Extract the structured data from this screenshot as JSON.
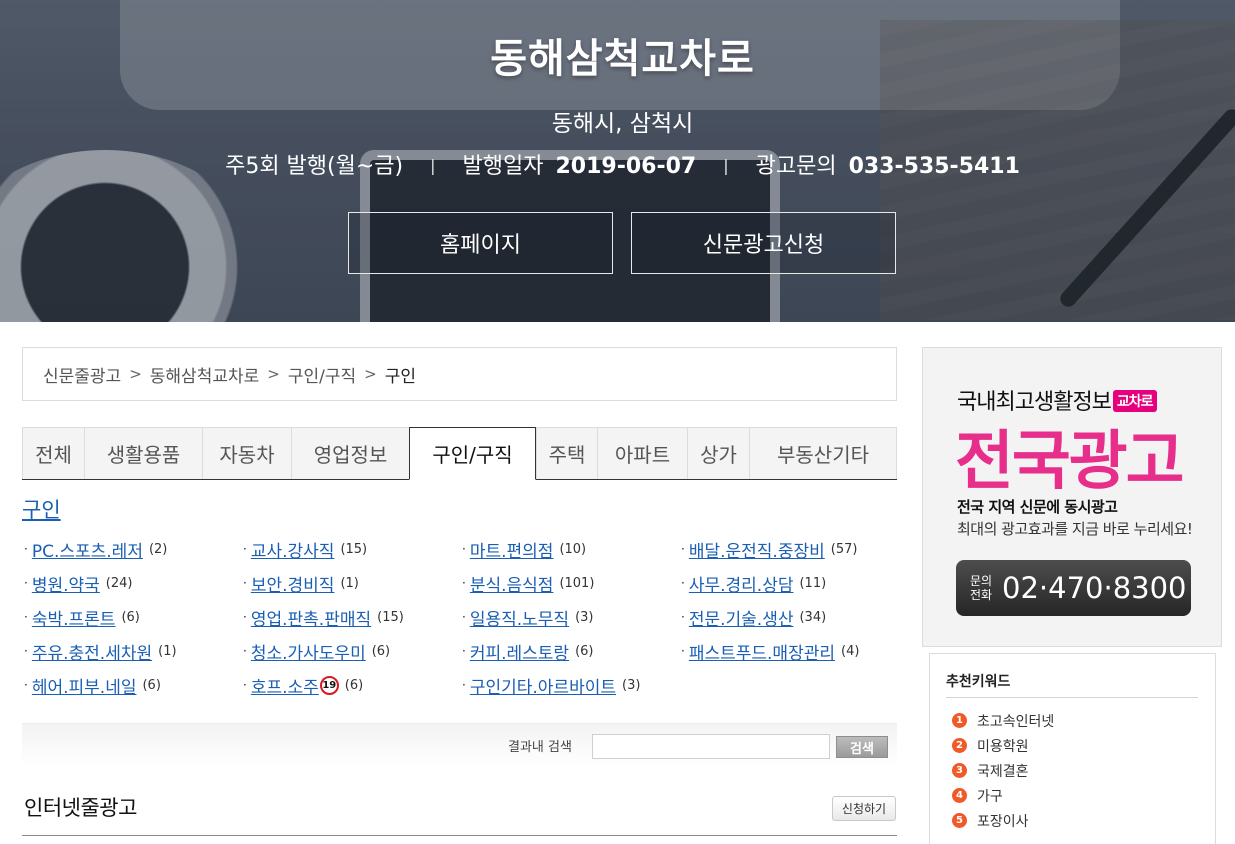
{
  "hero": {
    "title": "동해삼척교차로",
    "region": "동해시, 삼척시",
    "frequency": "주5회 발행(월~금)",
    "separator": "|",
    "issue_label": "발행일자",
    "issue_date": "2019-06-07",
    "ad_label": "광고문의",
    "ad_phone": "033-535-5411",
    "home_button": "홈페이지",
    "apply_button": "신문광고신청"
  },
  "breadcrumb": {
    "sep": ">",
    "items": [
      "신문줄광고",
      "동해삼척교차로",
      "구인/구직",
      "구인"
    ]
  },
  "tabs": [
    {
      "label": "전체"
    },
    {
      "label": "생활용품"
    },
    {
      "label": "자동차"
    },
    {
      "label": "영업정보"
    },
    {
      "label": "구인/구직"
    },
    {
      "label": "주택"
    },
    {
      "label": "아파트"
    },
    {
      "label": "상가"
    },
    {
      "label": "부동산기타"
    }
  ],
  "category": {
    "title": "구인",
    "bullet": "·",
    "items": [
      {
        "label": "PC.스포츠.레저",
        "count": "(2)"
      },
      {
        "label": "교사.강사직",
        "count": "(15)"
      },
      {
        "label": "마트.편의점",
        "count": "(10)"
      },
      {
        "label": "배달.운전직.중장비",
        "count": "(57)"
      },
      {
        "label": "병원.약국",
        "count": "(24)"
      },
      {
        "label": "보안.경비직",
        "count": "(1)"
      },
      {
        "label": "분식.음식점",
        "count": "(101)"
      },
      {
        "label": "사무.경리.상담",
        "count": "(11)"
      },
      {
        "label": "숙박.프론트",
        "count": "(6)"
      },
      {
        "label": "영업.판촉.판매직",
        "count": "(15)"
      },
      {
        "label": "일용직.노무직",
        "count": "(3)"
      },
      {
        "label": "전문.기술.생산",
        "count": "(34)"
      },
      {
        "label": "주유.충전.세차원",
        "count": "(1)"
      },
      {
        "label": "청소.가사도우미",
        "count": "(6)"
      },
      {
        "label": "커피.레스토랑",
        "count": "(6)"
      },
      {
        "label": "패스트푸드.매장관리",
        "count": "(4)"
      },
      {
        "label": "헤어.피부.네일",
        "count": "(6)"
      },
      {
        "label": "호프.소주",
        "count": "(6)",
        "badge": "19"
      },
      {
        "label": "구인기타.아르바이트",
        "count": "(3)"
      }
    ]
  },
  "search": {
    "label": "결과내 검색",
    "value": "",
    "button": "검색"
  },
  "internet_ads": {
    "title": "인터넷줄광고",
    "apply_button": "신청하기"
  },
  "banner": {
    "line1": "국내최고생활정보",
    "tag": "교차로",
    "main": "전국광고",
    "sub1": "전국 지역 신문에 동시광고",
    "sub2": "최대의 광고효과를 지금 바로 누리세요!",
    "phone_tag": "문의 전화",
    "phone": "02·470·8300",
    "accent_color": "#e62e8a"
  },
  "keywords": {
    "title": "추천키워드",
    "items": [
      {
        "num": "1",
        "label": "초고속인터넷"
      },
      {
        "num": "2",
        "label": "미용학원"
      },
      {
        "num": "3",
        "label": "국제결혼"
      },
      {
        "num": "4",
        "label": "가구"
      },
      {
        "num": "5",
        "label": "포장이사"
      }
    ]
  },
  "colors": {
    "link": "#1a5fb4",
    "keyword_badge": "#f05a28",
    "adult_badge": "#d71920"
  }
}
